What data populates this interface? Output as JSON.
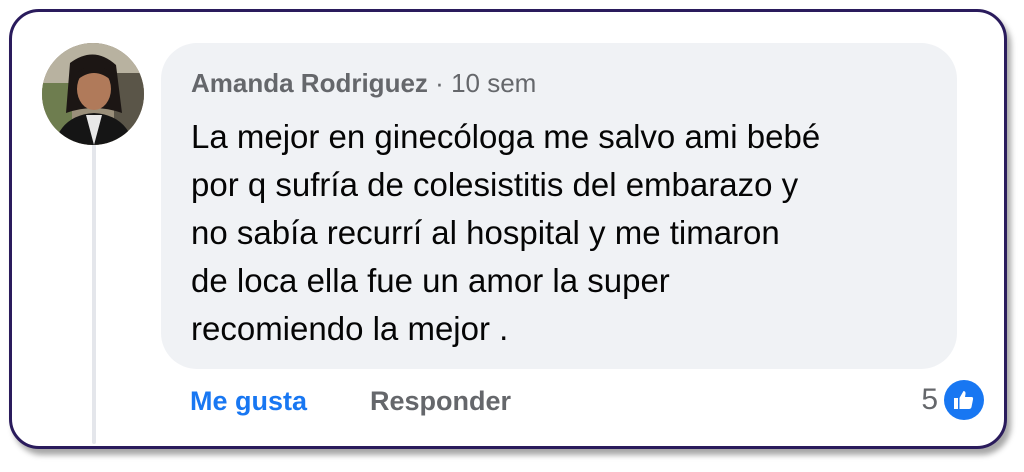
{
  "comment": {
    "author": "Amanda Rodriguez",
    "separator": "·",
    "time": "10 sem",
    "text": "La mejor en ginecóloga me salvo ami bebé\npor q sufría de colesistitis del embarazo  y\nno sabía recurrí al hospital  y me timaron\nde loca ella fue un amor la super\nrecomiendo  la mejor ."
  },
  "actions": {
    "like_label": "Me gusta",
    "reply_label": "Responder"
  },
  "reactions": {
    "count": "5",
    "icon": "thumbs-up-icon",
    "badge_color": "#1877f2"
  }
}
